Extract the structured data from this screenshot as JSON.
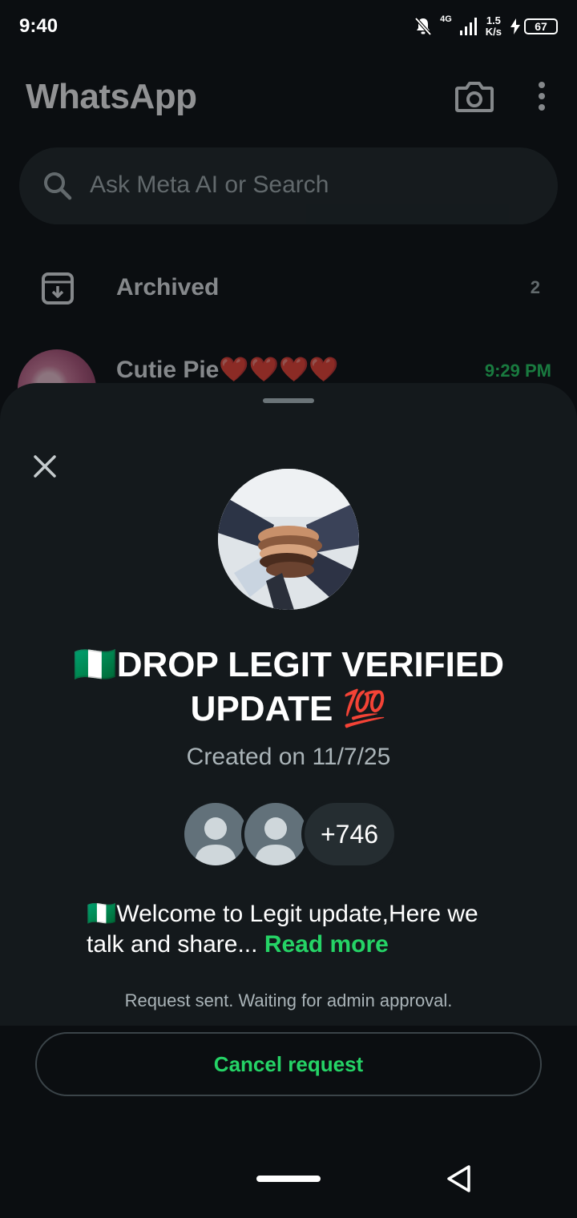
{
  "status_bar": {
    "time": "9:40",
    "network": "4G",
    "speed_value": "1.5",
    "speed_unit": "K/s",
    "battery": "67"
  },
  "header": {
    "title": "WhatsApp",
    "camera_icon": "camera-icon",
    "menu_icon": "more-vertical-icon"
  },
  "search": {
    "placeholder": "Ask Meta AI or Search"
  },
  "archived": {
    "label": "Archived",
    "count": "2"
  },
  "chat": {
    "name": "Cutie Pie❤️❤️❤️❤️",
    "time": "9:29 PM"
  },
  "sheet": {
    "group_title": "🇳🇬DROP LEGIT VERIFIED UPDATE 💯",
    "created": "Created on 11/7/25",
    "member_count": "+746",
    "description": "🇳🇬Welcome to Legit update,Here we talk and share...",
    "read_more": "Read more",
    "pending_note": "Request sent. Waiting for admin approval."
  },
  "actions": {
    "cancel_label": "Cancel request"
  },
  "colors": {
    "accent": "#25d366",
    "sheet_bg": "#14191c",
    "app_bg": "#0b0e11"
  }
}
